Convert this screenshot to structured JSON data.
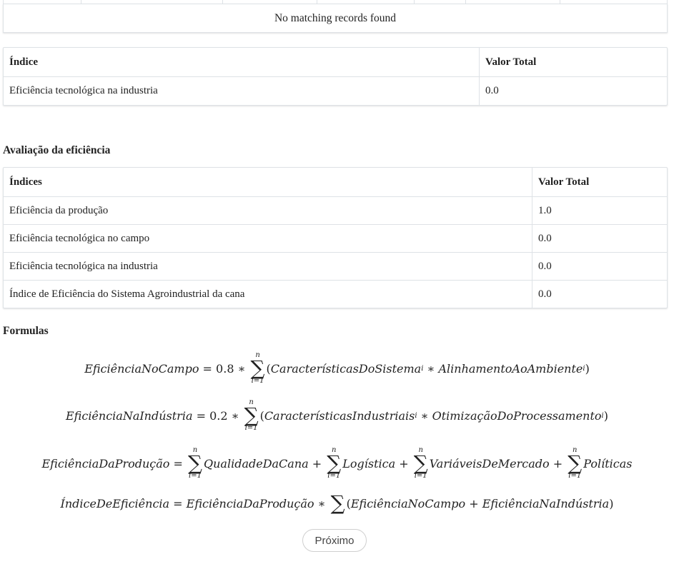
{
  "table1": {
    "empty_message": "No matching records found"
  },
  "table2": {
    "headers": [
      "Índice",
      "Valor Total"
    ],
    "rows": [
      [
        "Eficiência tecnológica na industria",
        "0.0"
      ]
    ]
  },
  "section_avaliacao": "Avaliação da eficiência",
  "table3": {
    "headers": [
      "Índices",
      "Valor Total"
    ],
    "rows": [
      [
        "Eficiência da produção",
        "1.0"
      ],
      [
        "Eficiência tecnológica no campo",
        "0.0"
      ],
      [
        "Eficiência tecnológica na industria",
        "0.0"
      ],
      [
        "Índice de Eficiência do Sistema Agroindustrial da cana",
        "0.0"
      ]
    ]
  },
  "section_formulas": "Formulas",
  "formulas": {
    "f1": {
      "lhs": "EficiênciaNoCampo",
      "coef": "0.8",
      "body_a": "CaracterísticasDoSistema",
      "body_b": "AlinhamentoAoAmbiente",
      "sub": "i"
    },
    "f2": {
      "lhs": "EficiênciaNaIndústria",
      "coef": "0.2",
      "body_a": "CaracterísticasIndustriais",
      "body_b": "OtimizaçãoDoProcessamento",
      "sub": "i"
    },
    "f3": {
      "lhs": "EficiênciaDaProdução",
      "t1": "QualidadeDaCana",
      "t2": "Logística",
      "t3": "VariáveisDeMercado",
      "t4": "Políticas"
    },
    "f4": {
      "lhs": "ÍndiceDeEficiência",
      "a": "EficiênciaDaProdução",
      "b": "EficiênciaNoCampo",
      "c": "EficiênciaNaIndústria"
    },
    "sum_upper": "n",
    "sum_lower": "i=1"
  },
  "next_button": "Próximo"
}
